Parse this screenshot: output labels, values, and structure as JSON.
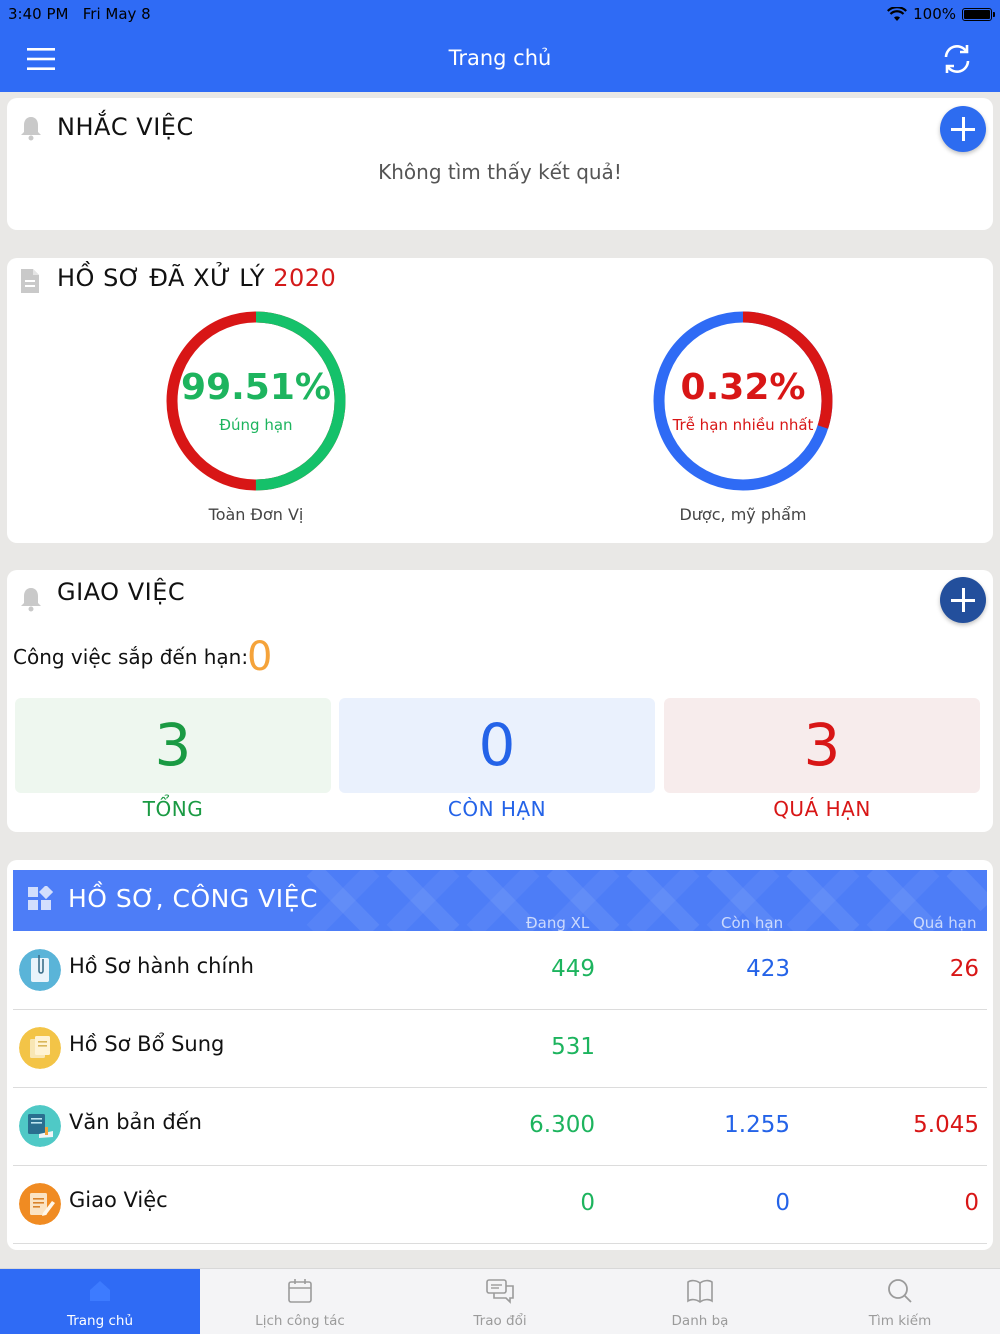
{
  "status_bar": {
    "time": "3:40 PM",
    "date": "Fri May 8",
    "battery": "100%"
  },
  "nav": {
    "title": "Trang chủ"
  },
  "reminders": {
    "title": "NHẮC VIỆC",
    "empty_text": "Không tìm thấy kết quả!"
  },
  "processed": {
    "title": "HỒ SƠ ĐÃ XỬ LÝ",
    "year": "2020",
    "gauges": [
      {
        "value_text": "99.51%",
        "value": 99.51,
        "sublabel": "Đúng hạn",
        "caption": "Toàn Đơn Vị",
        "value_color": "#1db45e",
        "fill_color": "#15c16a",
        "track_color": "#d81616"
      },
      {
        "value_text": "0.32%",
        "value": 0.32,
        "sublabel": "Trễ hạn nhiều nhất",
        "caption": "Dược, mỹ phẩm",
        "value_color": "#d81616",
        "fill_color": "#d81616",
        "track_color": "#2f6bf5"
      }
    ]
  },
  "assign": {
    "title": "GIAO VIỆC",
    "upcoming_label": "Công việc sắp đến hạn:",
    "upcoming_value": "0",
    "stats": [
      {
        "value": "3",
        "label": "TỔNG",
        "color": "#1a9a43",
        "bg": "#eef7ef"
      },
      {
        "value": "0",
        "label": "CÒN HẠN",
        "color": "#2463e8",
        "bg": "#eaf1fd"
      },
      {
        "value": "3",
        "label": "QUÁ HẠN",
        "color": "#d81616",
        "bg": "#f7ecec"
      }
    ]
  },
  "records": {
    "title": "HỒ SƠ, CÔNG VIỆC",
    "columns": [
      "Đang XL",
      "Còn hạn",
      "Quá hạn"
    ],
    "rows": [
      {
        "name": "Hồ Sơ hành chính",
        "icon": "paperclip-doc-icon",
        "in_progress": "449",
        "on_time": "423",
        "overdue": "26"
      },
      {
        "name": "Hồ Sơ Bổ Sung",
        "icon": "documents-icon",
        "in_progress": "531",
        "on_time": "",
        "overdue": ""
      },
      {
        "name": "Văn bản đến",
        "icon": "incoming-doc-icon",
        "in_progress": "6.300",
        "on_time": "1.255",
        "overdue": "5.045"
      },
      {
        "name": "Giao Việc",
        "icon": "assign-task-icon",
        "in_progress": "0",
        "on_time": "0",
        "overdue": "0"
      }
    ]
  },
  "tabs": [
    {
      "label": "Trang chủ",
      "icon": "home-icon",
      "active": true
    },
    {
      "label": "Lịch công tác",
      "icon": "calendar-icon",
      "active": false
    },
    {
      "label": "Trao đổi",
      "icon": "chat-icon",
      "active": false
    },
    {
      "label": "Danh bạ",
      "icon": "book-icon",
      "active": false
    },
    {
      "label": "Tìm kiếm",
      "icon": "search-icon",
      "active": false
    }
  ]
}
